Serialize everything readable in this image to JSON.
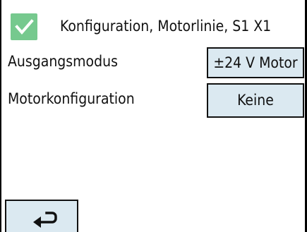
{
  "header": {
    "title": "Konfiguration, Motorlinie, S1 X1",
    "checkbox_icon": "checkmark-icon",
    "checkbox_checked": true,
    "checkbox_color": "#76c98e"
  },
  "rows": [
    {
      "label": "Ausgangsmodus",
      "value": "±24 V Motor"
    },
    {
      "label": "Motorkonfiguration",
      "value": "Keine"
    }
  ],
  "footer": {
    "back_icon": "return-arrow-icon"
  },
  "colors": {
    "button_background": "#dbe9f1",
    "border": "#111111"
  }
}
